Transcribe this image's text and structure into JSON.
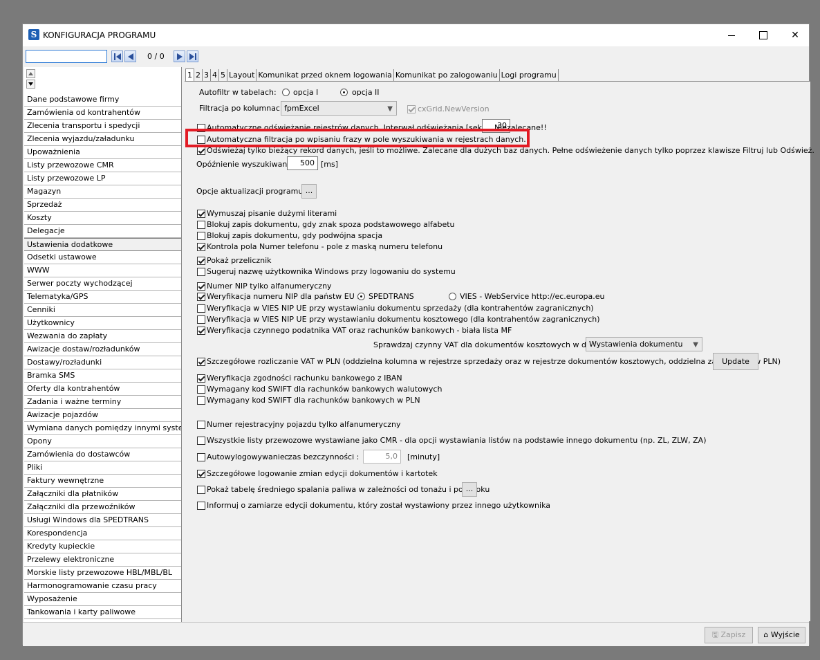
{
  "window": {
    "title": "KONFIGURACJA PROGRAMU",
    "icon_letter": "S"
  },
  "search": {
    "value": "",
    "counter": "0 / 0"
  },
  "menu": [
    "Dane podstawowe firmy",
    "Zamówienia od kontrahentów",
    "Zlecenia transportu i spedycji",
    "Zlecenia wyjazdu/załadunku",
    "Upoważnienia",
    "Listy przewozowe CMR",
    "Listy przewozowe LP",
    "Magazyn",
    "Sprzedaż",
    "Koszty",
    "Delegacje",
    "Ustawienia dodatkowe",
    "Odsetki ustawowe",
    "WWW",
    "Serwer poczty wychodzącej",
    "Telematyka/GPS",
    "Cenniki",
    "Użytkownicy",
    "Wezwania do zapłaty",
    "Awizacje dostaw/rozładunków",
    "Dostawy/rozładunki",
    "Bramka SMS",
    "Oferty dla kontrahentów",
    "Zadania i ważne terminy",
    "Awizacje pojazdów",
    "Wymiana danych pomiędzy innymi systemami",
    "Opony",
    "Zamówienia do dostawców",
    "Pliki",
    "Faktury wewnętrzne",
    "Załączniki dla płatników",
    "Załączniki dla przewoźników",
    "Usługi Windows dla SPEDTRANS",
    "Korespondencja",
    "Kredyty kupieckie",
    "Przelewy elektroniczne",
    "Morskie listy przewozowe HBL/MBL/BL",
    "Harmonogramowanie czasu pracy",
    "Wyposażenie",
    "Tankowania i karty paliwowe"
  ],
  "tabs": [
    "1",
    "2",
    "3",
    "4",
    "5",
    "Layout",
    "Komunikat przed oknem logowania",
    "Komunikat po zalogowaniu",
    "Logi programu"
  ],
  "settings": {
    "autofiltr_label": "Autofiltr w tabelach:",
    "opcja1": "opcja I",
    "opcja2": "opcja II",
    "filtracja_label": "Filtracja po kolumnach:",
    "filtracja_value": "fpmExcel",
    "cxgrid": "cxGrid.NewVersion",
    "auto_refresh": "Automatyczne odświeżanie rejestrów danych. Interwał odświeżania [sek.] :",
    "auto_refresh_value": "30",
    "niezalecane": "Niezalecane!!",
    "auto_filter": "Automatyczna filtracja po wpisaniu frazy w pole wyszukiwania w rejestrach danych.",
    "refresh_current": "Odświeżaj tylko bieżący rekord danych, jeśli to możliwe. Zalecane dla dużych baz danych. Pełne odświeżenie danych tylko poprzez klawisze Filtruj lub Odśwież.",
    "delay_label": "Opóźnienie wyszukiwania",
    "delay_value": "500",
    "delay_unit": "[ms]",
    "update_label": "Opcje aktualizacji programu",
    "ellipsis": "...",
    "uppercase": "Wymuszaj pisanie dużymi literami",
    "block_alphabet": "Blokuj zapis dokumentu, gdy znak spoza podstawowego alfabetu",
    "block_double_space": "Blokuj zapis dokumentu, gdy podwójna spacja",
    "phone_mask": "Kontrola pola Numer telefonu - pole z maską numeru telefonu",
    "calculator": "Pokaż przelicznik",
    "windows_user": "Sugeruj nazwę użytkownika Windows przy logowaniu do systemu",
    "nip_alnum": "Numer NIP tylko alfanumeryczny",
    "nip_eu": "Weryfikacja numeru NIP dla państw EU :",
    "spedtrans": "SPEDTRANS",
    "vies_ws": "VIES - WebService http://ec.europa.eu",
    "vies_sales": "Weryfikacja w VIES NIP UE przy wystawianiu dokumentu sprzedaży (dla kontrahentów zagranicznych)",
    "vies_cost": "Weryfikacja w VIES NIP UE przy wystawianiu dokumentu kosztowego (dla kontrahentów zagranicznych)",
    "vat_whitelist": "Weryfikacja czynnego podatnika VAT oraz rachunków bankowych - biała lista MF",
    "vat_check_label": "Sprawdzaj czynny VAT dla dokumentów kosztowych w dacie",
    "vat_check_value": "Wystawienia dokumentu",
    "vat_pln": "Szczegółowe rozliczanie VAT w PLN (oddzielna kolumna w rejestrze sprzedaży oraz w rejestrze dokumentów kosztowych, oddzielna zapłata VAT w PLN)",
    "update_btn": "Update",
    "iban": "Weryfikacja zgodności rachunku bankowego z IBAN",
    "swift_foreign": "Wymagany kod SWIFT dla rachunków bankowych walutowych",
    "swift_pln": "Wymagany kod SWIFT dla rachunków bankowych w PLN",
    "reg_alnum": "Numer rejestracyjny pojazdu tylko alfanumeryczny",
    "cmr_all": "Wszystkie listy przewozowe wystawiane jako CMR - dla opcji wystawiania listów na podstawie innego dokumentu (np. ZL, ZLW, ZA)",
    "autologout": "Autowylogowywanie :",
    "idle_label": "czas bezczynności :",
    "idle_value": "5,0",
    "idle_unit": "[minuty]",
    "detailed_log": "Szczegółowe logowanie zmian edycji dokumentów i kartotek",
    "fuel_table": "Pokaż tabelę średniego spalania paliwa w zależności od tonażu i pory roku",
    "inform_edit": "Informuj o zamiarze edycji dokumentu, który został wystawiony przez innego użytkownika"
  },
  "footer": {
    "save": "Zapisz",
    "exit": "Wyjście"
  }
}
